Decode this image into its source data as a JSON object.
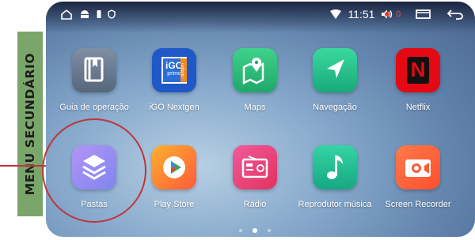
{
  "banner": {
    "label": "MENU SECUNDÁRIO",
    "color": "#7aa66b"
  },
  "status_bar": {
    "time": "11:51",
    "volume_count": "0",
    "left_icons": [
      "home-outline-icon",
      "android-icon",
      "sim-icon",
      "shield-icon"
    ],
    "right_icons": [
      "wifi-icon",
      "volume-icon",
      "recent-apps-icon",
      "back-icon"
    ]
  },
  "apps": [
    {
      "label": "Guia de operação",
      "icon": "book-icon"
    },
    {
      "label": "iGO Nextgen",
      "icon": "igo-icon",
      "badge_title": "iGO",
      "badge_sub": "primo",
      "badge_side": "nextgen"
    },
    {
      "label": "Maps",
      "icon": "map-pin-icon"
    },
    {
      "label": "Navegação",
      "icon": "navigation-arrow-icon"
    },
    {
      "label": "Netflix",
      "icon": "netflix-icon",
      "logo": "N"
    },
    {
      "label": "Pastas",
      "icon": "layers-icon"
    },
    {
      "label": "Play Store",
      "icon": "play-store-icon"
    },
    {
      "label": "Rádio",
      "icon": "radio-icon"
    },
    {
      "label": "Reprodutor música",
      "icon": "music-note-icon"
    },
    {
      "label": "Screen Recorder",
      "icon": "screen-recorder-icon"
    }
  ],
  "pager": {
    "pages": 3,
    "active_page": 2
  },
  "annotation": {
    "highlight": "Pastas",
    "color": "#c0353a"
  }
}
